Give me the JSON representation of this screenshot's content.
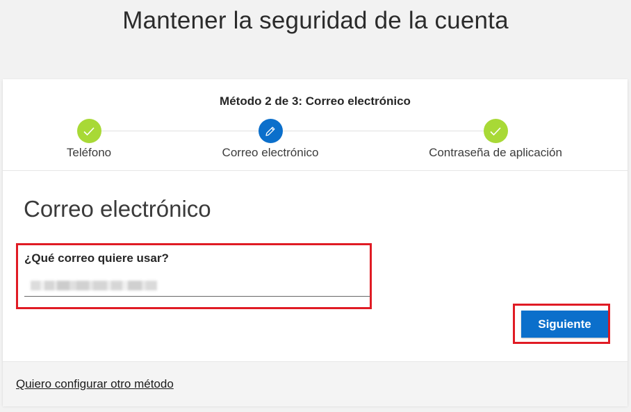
{
  "page": {
    "title": "Mantener la seguridad de la cuenta"
  },
  "progress": {
    "step_title": "Método 2 de 3: Correo electrónico",
    "steps": [
      {
        "label": "Teléfono",
        "status": "completed",
        "icon": "check-icon"
      },
      {
        "label": "Correo electrónico",
        "status": "current",
        "icon": "pencil-icon"
      },
      {
        "label": "Contraseña de aplicación",
        "status": "completed",
        "icon": "check-icon"
      }
    ]
  },
  "form": {
    "section_title": "Correo electrónico",
    "email_label": "¿Qué correo quiere usar?",
    "email_value_state": "blurred"
  },
  "actions": {
    "next_label": "Siguiente"
  },
  "footer": {
    "other_method_link": "Quiero configurar otro método"
  },
  "colors": {
    "accent": "#0b6fcb",
    "completed": "#a8d936",
    "highlight": "#e01b24",
    "background": "#f2f2f2"
  }
}
